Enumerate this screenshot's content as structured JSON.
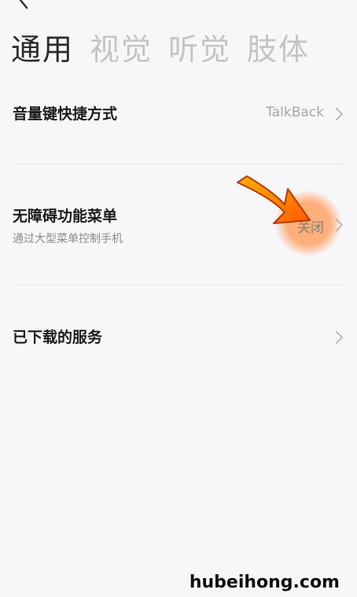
{
  "tabs": [
    {
      "label": "通用"
    },
    {
      "label": "视觉"
    },
    {
      "label": "听觉"
    },
    {
      "label": "肢体"
    }
  ],
  "items": [
    {
      "title": "音量键快捷方式",
      "value": "TalkBack"
    },
    {
      "title": "无障碍功能菜单",
      "subtitle": "通过大型菜单控制手机",
      "value": "关闭"
    },
    {
      "title": "已下载的服务"
    }
  ],
  "watermark": "hubeihong.com",
  "colors": {
    "background": "#f7f7f9",
    "highlight": "#ff8c2a",
    "arrow": "#ff7a00"
  }
}
